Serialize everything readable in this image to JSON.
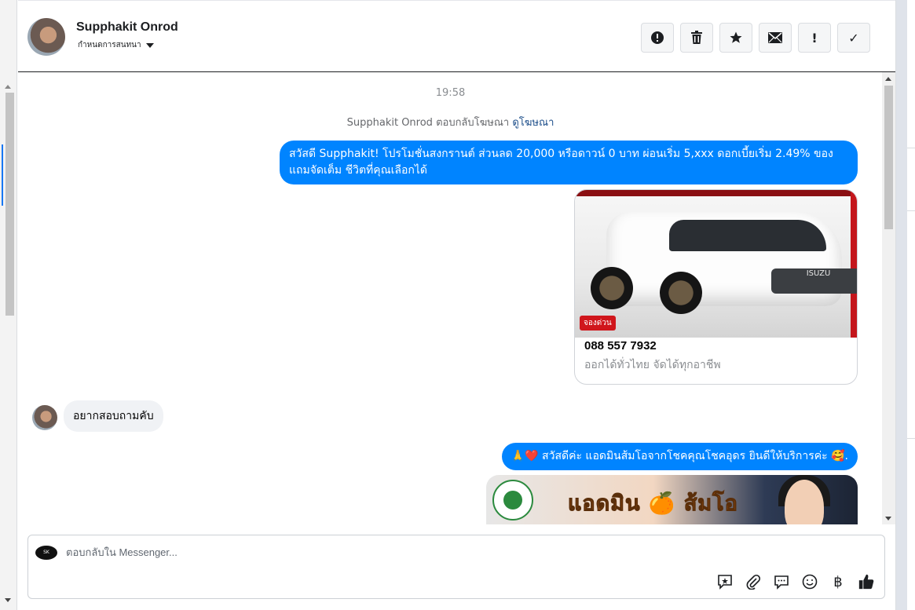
{
  "header": {
    "name": "Supphakit Onrod",
    "assign_label": "กำหนดการสนทนา",
    "tools": [
      {
        "name": "report-icon",
        "glyph": "!"
      },
      {
        "name": "trash-icon",
        "glyph": "🗑"
      },
      {
        "name": "star-icon",
        "glyph": "★"
      },
      {
        "name": "mail-icon",
        "glyph": "✉"
      },
      {
        "name": "exclamation-icon",
        "glyph": "!"
      },
      {
        "name": "check-icon",
        "glyph": "✓"
      }
    ]
  },
  "chat": {
    "timestamp": "19:58",
    "ad_reply_prefix": "Supphakit Onrod ตอบกลับโฆษณา",
    "ad_reply_link": "ดูโฆษณา",
    "message1_line1": "สวัสดี Supphakit! โปรโมชั่นสงกรานต์ ส่วนลด 20,000 หรือดาวน์ 0 บาท ผ่อนเริ่ม 5,xxx ดอกเบี้ยเริ่ม 2.49% ของ",
    "message1_line2": "แถมจัดเต็ม ชีวิตที่คุณเลือกได้",
    "card": {
      "image_brand": "ISUZU",
      "image_badge": "จองด่วน",
      "title": "088 557 7932",
      "subtitle": "ออกได้ทั่วไทย จัดได้ทุกอาชีพ"
    },
    "incoming_message": "อยากสอบถามคับ",
    "message2": "🙏❤️ สวัสดีค่ะ แอดมินส้มโอจากโชคคุณโชคอุดร ยินดีให้บริการค่ะ 🥰.",
    "admin_banner_text": "แอดมิน 🍊 ส้มโอ"
  },
  "composer": {
    "placeholder": "ตอบกลับใน Messenger...",
    "tools": [
      {
        "name": "saved-reply-icon",
        "glyph": "✪"
      },
      {
        "name": "attach-icon",
        "glyph": "📎"
      },
      {
        "name": "chat-bubble-icon",
        "glyph": "💬"
      },
      {
        "name": "emoji-icon",
        "glyph": "☺"
      },
      {
        "name": "baht-icon",
        "glyph": "฿"
      },
      {
        "name": "like-icon",
        "glyph": "👍"
      }
    ]
  },
  "colors": {
    "accent": "#0084ff",
    "incoming_bubble": "#f0f2f5"
  }
}
